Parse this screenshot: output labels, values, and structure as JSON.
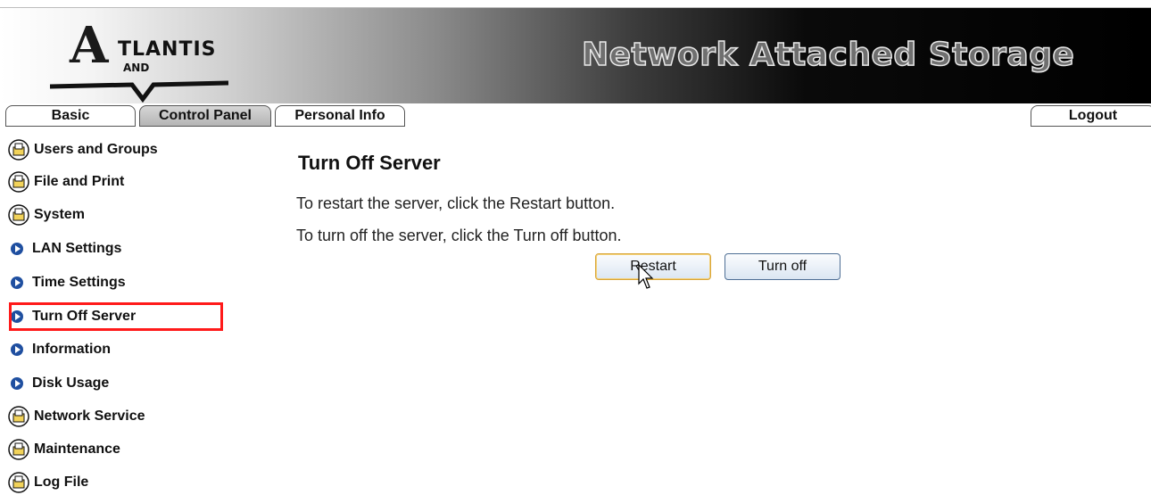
{
  "header": {
    "logo_text": "TLANTIS",
    "logo_sub": "AND",
    "logo_a": "A",
    "title": "Network Attached Storage"
  },
  "tabs": {
    "basic": "Basic",
    "control_panel": "Control Panel",
    "personal_info": "Personal Info",
    "logout": "Logout"
  },
  "sidebar": {
    "items": [
      {
        "label": "Users and Groups",
        "icon": "folder-icon"
      },
      {
        "label": "File and Print",
        "icon": "folder-icon"
      },
      {
        "label": "System",
        "icon": "folder-icon"
      },
      {
        "label": "LAN Settings",
        "icon": "arrow-icon"
      },
      {
        "label": "Time Settings",
        "icon": "arrow-icon"
      },
      {
        "label": "Turn Off Server",
        "icon": "arrow-icon"
      },
      {
        "label": "Information",
        "icon": "arrow-icon"
      },
      {
        "label": "Disk Usage",
        "icon": "arrow-icon"
      },
      {
        "label": "Network Service",
        "icon": "folder-icon"
      },
      {
        "label": "Maintenance",
        "icon": "folder-icon"
      },
      {
        "label": "Log File",
        "icon": "folder-icon"
      }
    ],
    "selected": "Turn Off Server"
  },
  "main": {
    "title": "Turn Off Server",
    "line1": "To restart the server, click the Restart button.",
    "line2": "To turn off the server, click the Turn off button.",
    "restart_label": "Restart",
    "turnoff_label": "Turn off"
  },
  "colors": {
    "highlight": "#ff1a1a",
    "arrow_bullet": "#1f4fa0"
  }
}
